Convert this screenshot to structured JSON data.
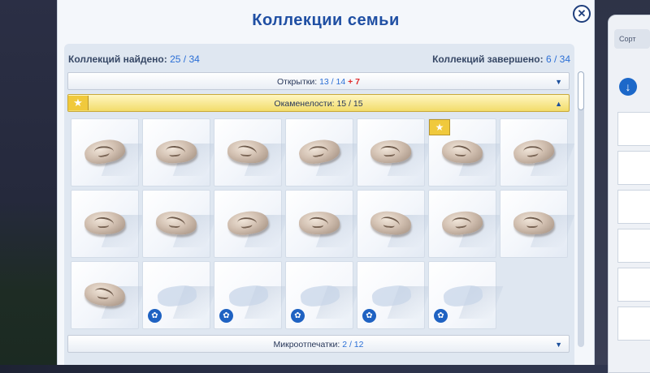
{
  "dialog": {
    "title": "Коллекции семьи",
    "stats": {
      "found_label": "Коллекций найдено:",
      "found_value": "25 / 34",
      "completed_label": "Коллекций завершено:",
      "completed_value": "6 / 34"
    }
  },
  "collections": [
    {
      "label": "Открытки:",
      "count": "13 / 14",
      "new": "+ 7",
      "state": "collapsed"
    },
    {
      "label": "Окаменелости:",
      "count": "15 / 15",
      "new": "",
      "state": "expanded"
    },
    {
      "label": "Микроотпечатки:",
      "count": "2 / 12",
      "new": "",
      "state": "collapsed"
    }
  ],
  "fossils": {
    "total_slots": 20,
    "found": 15,
    "starred_index": 5
  },
  "sidebar": {
    "sort_label": "Сорт"
  },
  "colors": {
    "title": "#1f4fa3",
    "accent_blue": "#2b6fd6",
    "new_red": "#e02c2c",
    "expanded_bar": "#f2dc6a"
  },
  "icons": {
    "close": "close-icon",
    "caret_down": "chevron-down-icon",
    "caret_up": "chevron-up-icon",
    "star": "star-icon",
    "locked": "locked-item-icon"
  }
}
